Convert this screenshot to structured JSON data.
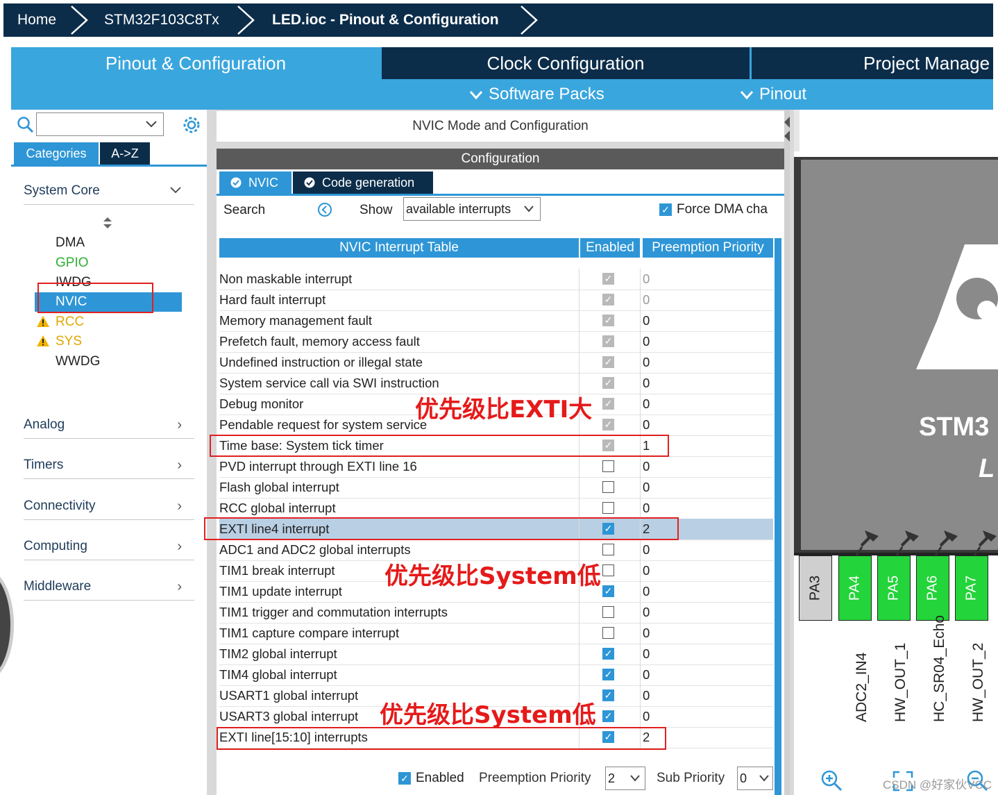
{
  "breadcrumb": {
    "home": "Home",
    "device": "STM32F103C8Tx",
    "current": "LED.ioc - Pinout & Configuration"
  },
  "tabs": {
    "pinout": "Pinout & Configuration",
    "clock": "Clock Configuration",
    "project": "Project Manage",
    "software_packs": "Software Packs",
    "pinout_menu": "Pinout"
  },
  "left_panel": {
    "search_placeholder": "",
    "categories_tab": "Categories",
    "az_tab": "A->Z",
    "system_core": "System Core",
    "peripherals": [
      {
        "label": "DMA",
        "color": "#222222"
      },
      {
        "label": "GPIO",
        "color": "#2fae34"
      },
      {
        "label": "IWDG",
        "color": "#222222"
      },
      {
        "label": "NVIC",
        "color": "#ffffff"
      },
      {
        "label": "RCC",
        "color": "#e0a800"
      },
      {
        "label": "SYS",
        "color": "#e0a800"
      },
      {
        "label": "WWDG",
        "color": "#222222"
      }
    ],
    "categories": [
      "Analog",
      "Timers",
      "Connectivity",
      "Computing",
      "Middleware"
    ]
  },
  "middle": {
    "mode_title": "NVIC Mode and Configuration",
    "configuration_header": "Configuration",
    "subtab_nvic": "NVIC",
    "subtab_codegen": "Code generation",
    "search_label": "Search",
    "show_label": "Show",
    "show_value": "available interrupts",
    "force_dma": "Force DMA cha",
    "columns": {
      "table": "NVIC Interrupt Table",
      "enabled": "Enabled",
      "preemption": "Preemption Priority"
    },
    "rows": [
      {
        "name": "Non maskable interrupt",
        "enabled": "fixed",
        "priority": "0",
        "gray": true
      },
      {
        "name": "Hard fault interrupt",
        "enabled": "fixed",
        "priority": "0",
        "gray": true
      },
      {
        "name": "Memory management fault",
        "enabled": "fixed",
        "priority": "0",
        "gray": false
      },
      {
        "name": "Prefetch fault, memory access fault",
        "enabled": "fixed",
        "priority": "0",
        "gray": false
      },
      {
        "name": "Undefined instruction or illegal state",
        "enabled": "fixed",
        "priority": "0",
        "gray": false
      },
      {
        "name": "System service call via SWI instruction",
        "enabled": "fixed",
        "priority": "0",
        "gray": false
      },
      {
        "name": "Debug monitor",
        "enabled": "fixed",
        "priority": "0",
        "gray": false
      },
      {
        "name": "Pendable request for system service",
        "enabled": "fixed",
        "priority": "0",
        "gray": false
      },
      {
        "name": "Time base: System tick timer",
        "enabled": "fixed",
        "priority": "1",
        "gray": false
      },
      {
        "name": "PVD interrupt through EXTI line 16",
        "enabled": "off",
        "priority": "0",
        "gray": false
      },
      {
        "name": "Flash global interrupt",
        "enabled": "off",
        "priority": "0",
        "gray": false
      },
      {
        "name": "RCC global interrupt",
        "enabled": "off",
        "priority": "0",
        "gray": false
      },
      {
        "name": "EXTI line4 interrupt",
        "enabled": "on",
        "priority": "2",
        "gray": false,
        "selected": true
      },
      {
        "name": "ADC1 and ADC2 global interrupts",
        "enabled": "off",
        "priority": "0",
        "gray": false
      },
      {
        "name": "TIM1 break interrupt",
        "enabled": "off",
        "priority": "0",
        "gray": false
      },
      {
        "name": "TIM1 update interrupt",
        "enabled": "on",
        "priority": "0",
        "gray": false
      },
      {
        "name": "TIM1 trigger and commutation interrupts",
        "enabled": "off",
        "priority": "0",
        "gray": false
      },
      {
        "name": "TIM1 capture compare interrupt",
        "enabled": "off",
        "priority": "0",
        "gray": false
      },
      {
        "name": "TIM2 global interrupt",
        "enabled": "on",
        "priority": "0",
        "gray": false
      },
      {
        "name": "TIM4 global interrupt",
        "enabled": "on",
        "priority": "0",
        "gray": false
      },
      {
        "name": "USART1 global interrupt",
        "enabled": "on",
        "priority": "0",
        "gray": false
      },
      {
        "name": "USART3 global interrupt",
        "enabled": "on",
        "priority": "0",
        "gray": false
      },
      {
        "name": "EXTI line[15:10] interrupts",
        "enabled": "on",
        "priority": "2",
        "gray": false
      }
    ],
    "footer": {
      "enabled_label": "Enabled",
      "preemption_label": "Preemption Priority",
      "preemption_value": "2",
      "sub_label": "Sub Priority",
      "sub_value": "0"
    }
  },
  "annotations": {
    "higher": "优先级比EXTI大",
    "lower1": "优先级比System低",
    "lower2": "优先级比System低"
  },
  "chip": {
    "label_line1": "STM3",
    "label_line2": "L",
    "pins": [
      {
        "name": "PA3",
        "color": "#cfcfcf"
      },
      {
        "name": "PA4",
        "color": "#23d43a"
      },
      {
        "name": "PA5",
        "color": "#23d43a"
      },
      {
        "name": "PA6",
        "color": "#23d43a"
      },
      {
        "name": "PA7",
        "color": "#23d43a"
      }
    ],
    "signals": [
      "ADC2_IN4",
      "HW_OUT_1",
      "HC_SR04_Echo",
      "HW_OUT_2"
    ]
  },
  "watermark": "CSDN @好家伙VCC"
}
